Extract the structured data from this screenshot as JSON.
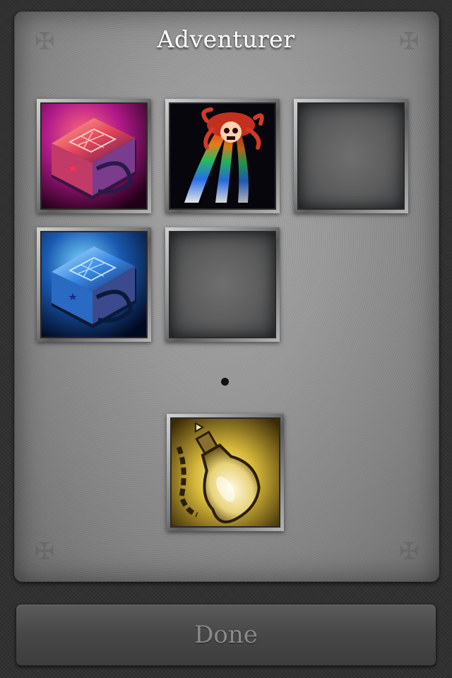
{
  "header": {
    "title": "Adventurer"
  },
  "slots": [
    {
      "name": "spellbook-red",
      "icon": "red-spellbook-icon",
      "filled": true
    },
    {
      "name": "rainbow-skull-spell",
      "icon": "rainbow-skull-icon",
      "filled": true
    },
    {
      "name": "empty-slot",
      "icon": "",
      "filled": false
    },
    {
      "name": "spellbook-blue",
      "icon": "blue-spellbook-icon",
      "filled": true
    },
    {
      "name": "empty-slot",
      "icon": "",
      "filled": false
    }
  ],
  "reward": {
    "icon": "golden-potion-flask-icon"
  },
  "footer": {
    "done_label": "Done"
  },
  "colors": {
    "panel": "#9a9a9a",
    "background": "#2e2e2e",
    "title": "#ffffff",
    "done_text": "#8a8a8a",
    "gold": "#d8b93a"
  }
}
